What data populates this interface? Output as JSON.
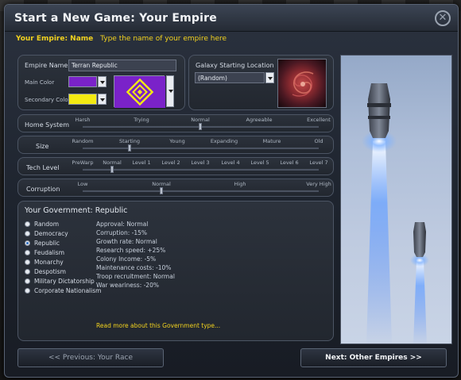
{
  "window": {
    "title": "Start a New Game: Your Empire"
  },
  "empire": {
    "label": "Your Empire: Name",
    "hint": "Type the name of your empire here",
    "name_label": "Empire Name",
    "name_value": "Terran Republic",
    "main_color_label": "Main Color",
    "main_color": "#7a22c9",
    "secondary_color_label": "Secondary Color",
    "secondary_color": "#f3ea12"
  },
  "galaxy": {
    "label": "Galaxy Starting Location",
    "value": "(Random)"
  },
  "sliders": [
    {
      "label": "Home System",
      "ticks": [
        "Harsh",
        "Trying",
        "Normal",
        "Agreeable",
        "Excellent"
      ],
      "value": 0.5
    },
    {
      "label": "Size",
      "ticks": [
        "Random",
        "Starting",
        "Young",
        "Expanding",
        "Mature",
        "Old"
      ],
      "value": 0.2
    },
    {
      "label": "Tech Level",
      "ticks": [
        "PreWarp",
        "Normal",
        "Level 1",
        "Level 2",
        "Level 3",
        "Level 4",
        "Level 5",
        "Level 6",
        "Level 7"
      ],
      "value": 0.125
    },
    {
      "label": "Corruption",
      "ticks": [
        "Low",
        "Normal",
        "High",
        "Very High"
      ],
      "value": 0.333
    }
  ],
  "government": {
    "title": "Your Government: Republic",
    "options": [
      "Random",
      "Democracy",
      "Republic",
      "Feudalism",
      "Monarchy",
      "Despotism",
      "Military Dictatorship",
      "Corporate Nationalism"
    ],
    "selected": "Republic",
    "stats": [
      "Approval: Normal",
      "Corruption: -15%",
      "Growth rate: Normal",
      "Research speed: +25%",
      "Colony Income: -5%",
      "Maintenance costs: -10%",
      "Troop recruitment: Normal",
      "War weariness: -20%"
    ],
    "read_more": "Read more about this Government type..."
  },
  "buttons": {
    "previous": "<< Previous: Your Race",
    "next": "Next: Other Empires >>"
  }
}
